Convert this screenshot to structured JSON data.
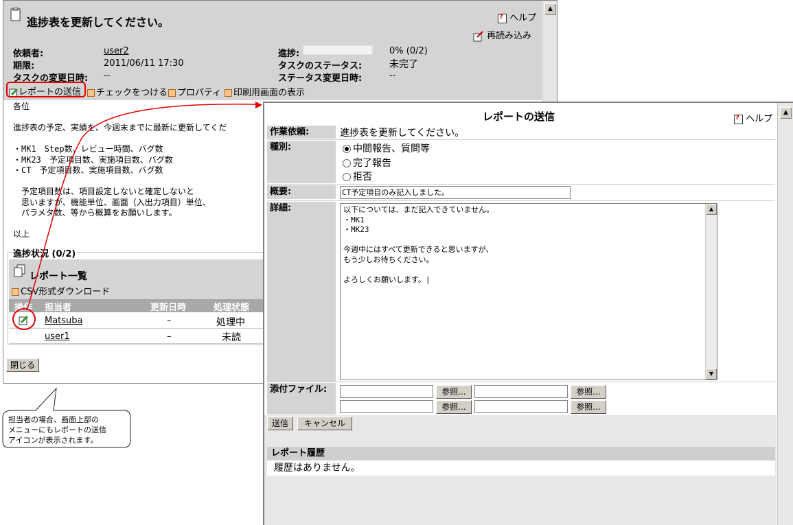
{
  "back": {
    "title": "進捗表を更新してください。",
    "help": "ヘルプ",
    "reload": "再読み込み",
    "info": {
      "requester_label": "依頼者:",
      "requester": "user2",
      "deadline_label": "期限:",
      "deadline": "2011/06/11 17:30",
      "changed_label": "タスクの変更日時:",
      "changed": "--",
      "progress_label": "進捗:",
      "progress_text": "0% (0/2)",
      "progress_fraction": 0,
      "status_label": "タスクのステータス:",
      "status": "未完了",
      "status_changed_label": "ステータス変更日時:",
      "status_changed": "--"
    },
    "menu": {
      "send_report": "レポートの送信",
      "check": "チェックをつける",
      "property": "プロパティ",
      "print": "印刷用画面の表示"
    },
    "body_lines": [
      "各位",
      "",
      "進捗表の予定、実績を、今週末までに最新に更新してくだ",
      "",
      "・MK1　Step数、レビュー時間、バグ数",
      "・MK23　予定項目数、実施項目数、バグ数",
      "・CT　予定項目数、実施項目数、バグ数",
      "",
      "　予定項目数は、項目設定しないと確定しないと",
      "　思いますが、機能単位、画面（入出力項目）単位、",
      "　パラメタ数、等から概算をお願いします。",
      "",
      "以上"
    ],
    "progress_section": "進捗状況 (0/2)",
    "report_list": "レポート一覧",
    "csv": "CSV形式ダウンロード",
    "table": {
      "headers": [
        "操作",
        "担当者",
        "更新日時",
        "処理状態"
      ],
      "rows": [
        {
          "user": "Matsuba",
          "date": "–",
          "state": "処理中"
        },
        {
          "user": "user1",
          "date": "–",
          "state": "未読"
        }
      ]
    },
    "close": "閉じる"
  },
  "callout": {
    "lines": [
      "担当者の場合、画面上部の",
      "メニューにもレポートの送信",
      "アイコンが表示されます。"
    ]
  },
  "popup": {
    "title": "レポートの送信",
    "help": "ヘルプ",
    "task_label": "作業依頼:",
    "task": "進捗表を更新してください。",
    "type_label": "種別:",
    "types": [
      "中間報告、質問等",
      "完了報告",
      "拒否"
    ],
    "summary_label": "概要:",
    "summary": "CT予定項目のみ記入しました。",
    "detail_label": "詳細:",
    "detail_lines": [
      "以下については、まだ記入できていません。",
      "・MK1",
      "・MK23",
      "",
      "今週中にはすべて更新できると思いますが、",
      "もう少しお待ちください。",
      "",
      "よろしくお願いします。|"
    ],
    "attach_label": "添付ファイル:",
    "browse": "参照...",
    "send": "送信",
    "cancel": "キャンセル",
    "history_title": "レポート履歴",
    "history_empty": "履歴はありません。"
  },
  "colors": {
    "annotation": "#e00000",
    "panel": "#d4d4d4"
  }
}
